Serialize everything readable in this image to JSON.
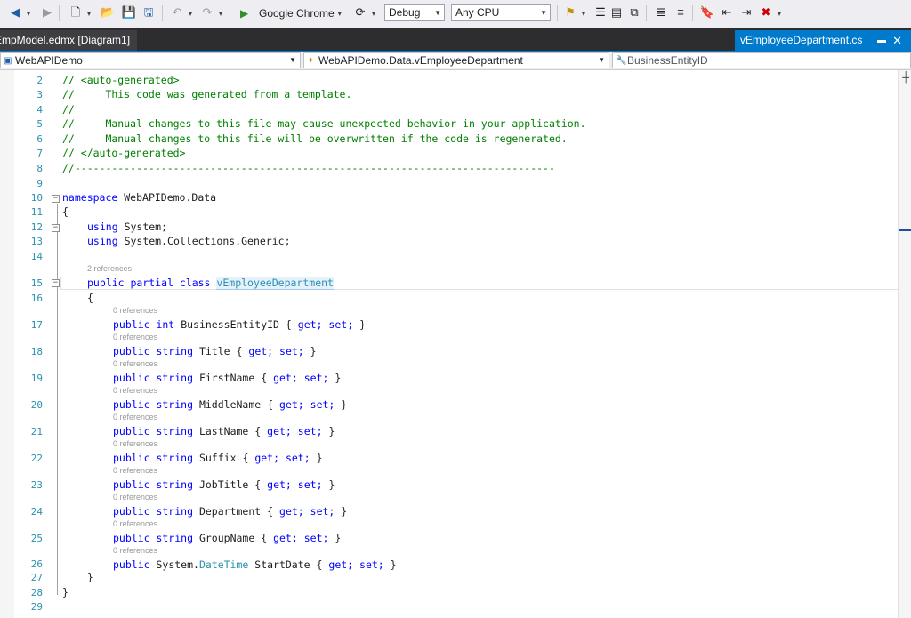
{
  "toolbar": {
    "run_target": "Google Chrome",
    "configuration": "Debug",
    "platform": "Any CPU"
  },
  "tabs": {
    "left": "EmpModel.edmx [Diagram1]",
    "active": "vEmployeeDepartment.cs"
  },
  "navbar": {
    "project": "WebAPIDemo",
    "type": "WebAPIDemo.Data.vEmployeeDepartment",
    "member": "BusinessEntityID"
  },
  "code": {
    "line_numbers": [
      "2",
      "3",
      "4",
      "5",
      "6",
      "7",
      "8",
      "9",
      "10",
      "11",
      "12",
      "13",
      "14",
      "15",
      "16",
      "17",
      "18",
      "19",
      "20",
      "21",
      "22",
      "23",
      "24",
      "25",
      "26",
      "27",
      "28",
      "29"
    ],
    "header_lines": [
      "// <auto-generated>",
      "//     This code was generated from a template.",
      "//",
      "//     Manual changes to this file may cause unexpected behavior in your application.",
      "//     Manual changes to this file will be overwritten if the code is regenerated.",
      "// </auto-generated>",
      "//------------------------------------------------------------------------------"
    ],
    "namespace_kw": "namespace",
    "namespace_name": "WebAPIDemo.Data",
    "open_brace": "{",
    "close_brace": "}",
    "using_kw": "using",
    "using1": "System;",
    "using2": "System.Collections.Generic;",
    "class_refs": "2 references",
    "class_modifiers": "public partial class",
    "class_name": "vEmployeeDepartment",
    "prop_refs": "0 references",
    "properties": [
      {
        "mods": "public int",
        "name": "BusinessEntityID"
      },
      {
        "mods": "public string",
        "name": "Title"
      },
      {
        "mods": "public string",
        "name": "FirstName"
      },
      {
        "mods": "public string",
        "name": "MiddleName"
      },
      {
        "mods": "public string",
        "name": "LastName"
      },
      {
        "mods": "public string",
        "name": "Suffix"
      },
      {
        "mods": "public string",
        "name": "JobTitle"
      },
      {
        "mods": "public string",
        "name": "Department"
      },
      {
        "mods": "public string",
        "name": "GroupName"
      },
      {
        "mods": "public System.",
        "type": "DateTime",
        "name": "StartDate"
      }
    ],
    "accessors_open": "{",
    "get_kw": "get;",
    "set_kw": "set;",
    "accessors_close": "}"
  },
  "colors": {
    "accent": "#007acc",
    "comment": "#008000",
    "keyword": "#0000ff",
    "type": "#2b91af"
  }
}
